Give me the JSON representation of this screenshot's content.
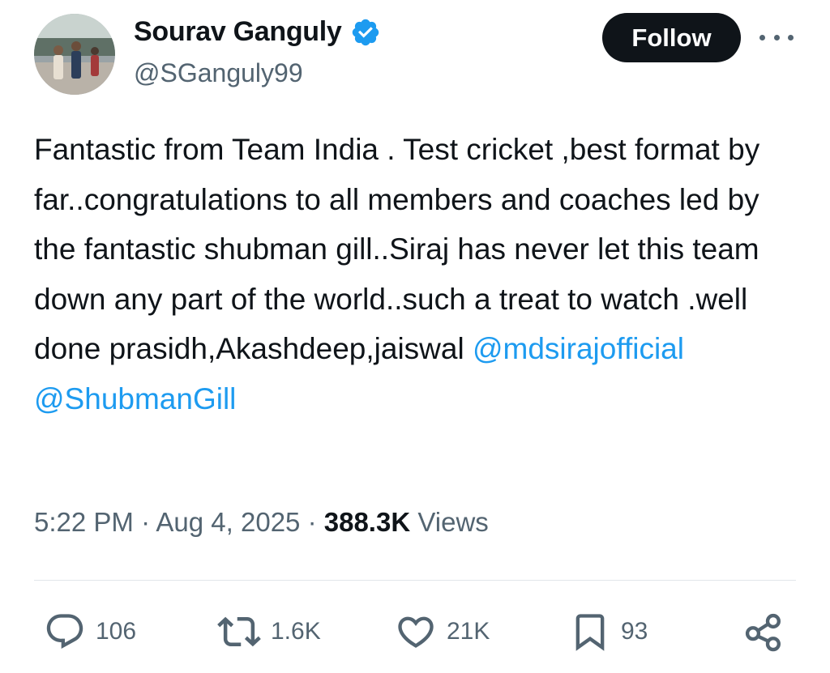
{
  "author": {
    "display_name": "Sourav Ganguly",
    "handle": "@SGanguly99",
    "verified": true,
    "verified_color": "#1d9bf0"
  },
  "follow_button": {
    "label": "Follow"
  },
  "more_menu": {
    "icon": "more-horizontal-icon"
  },
  "tweet": {
    "text": "Fantastic from Team India . Test cricket ,best format by far..congratulations to all members and coaches led by the fantastic shubman gill..Siraj has never let this team down any part of the world..such a treat to watch .well done prasidh,Akashdeep,jaiswal ",
    "mention_1": "@mdsirajofficial",
    "mention_2": "@ShubmanGill",
    "mention_color": "#1d9bf0"
  },
  "meta": {
    "time": "5:22 PM",
    "separator": " · ",
    "date": "Aug 4, 2025",
    "views_count": "388.3K",
    "views_label": " Views"
  },
  "actions": {
    "reply": {
      "icon": "reply-icon",
      "count": "106"
    },
    "repost": {
      "icon": "repost-icon",
      "count": "1.6K"
    },
    "like": {
      "icon": "heart-icon",
      "count": "21K"
    },
    "bookmark": {
      "icon": "bookmark-icon",
      "count": "93"
    },
    "share": {
      "icon": "share-icon"
    }
  }
}
